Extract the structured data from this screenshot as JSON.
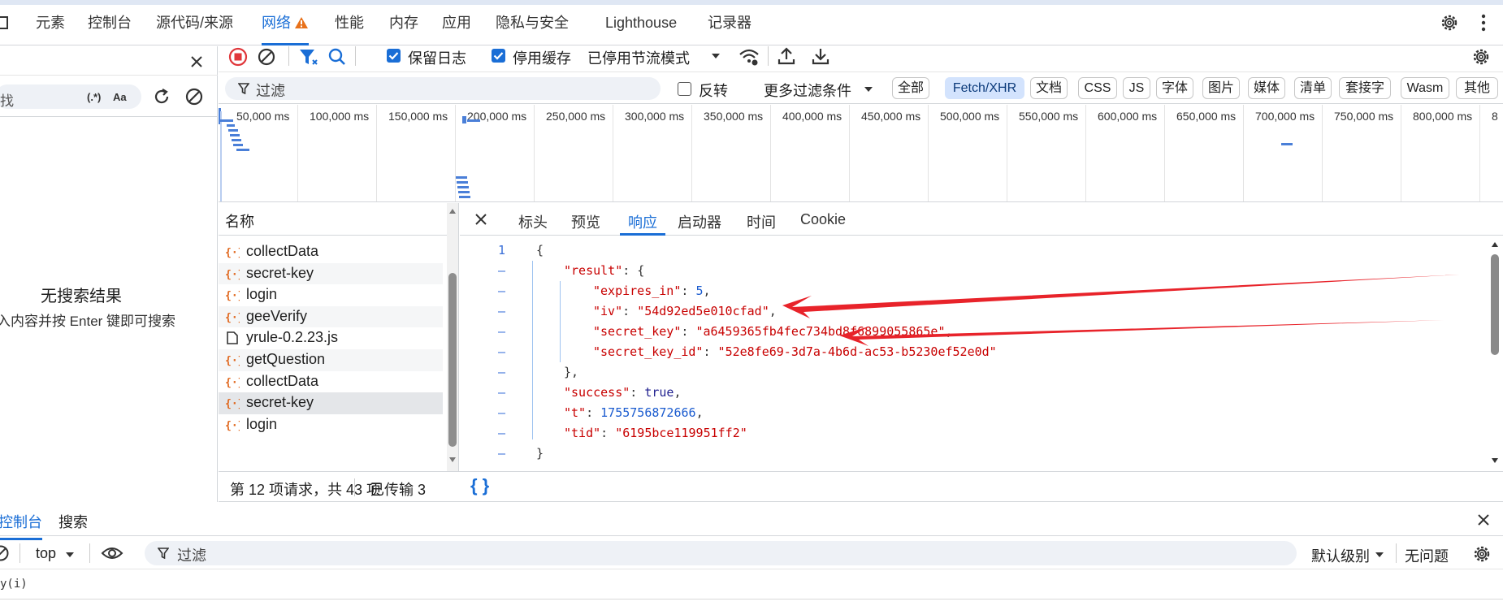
{
  "top_tabs": [
    "元素",
    "控制台",
    "源代码/来源",
    "网络",
    "性能",
    "内存",
    "应用",
    "隐私与安全",
    "Lighthouse",
    "记录器"
  ],
  "active_top_tab": "网络",
  "search_pane": {
    "placeholder": "找",
    "regex_toggle": "(.*)",
    "case_toggle": "Aa",
    "no_results_title": "无搜索结果",
    "no_results_hint": "入内容并按 Enter 键即可搜索"
  },
  "toolbar": {
    "preserve_log_label": "保留日志",
    "preserve_log_checked": true,
    "disable_cache_label": "停用缓存",
    "disable_cache_checked": true,
    "throttling_value": "已停用节流模式"
  },
  "filter": {
    "placeholder": "过滤",
    "invert_label": "反转",
    "invert_checked": false,
    "more_filters_label": "更多过滤条件",
    "types": [
      "全部",
      "Fetch/XHR",
      "文档",
      "CSS",
      "JS",
      "字体",
      "图片",
      "媒体",
      "清单",
      "套接字",
      "Wasm",
      "其他"
    ],
    "active_type": "Fetch/XHR"
  },
  "overview": {
    "tick_labels": [
      "50,000 ms",
      "100,000 ms",
      "150,000 ms",
      "200,000 ms",
      "250,000 ms",
      "300,000 ms",
      "350,000 ms",
      "400,000 ms",
      "450,000 ms",
      "500,000 ms",
      "550,000 ms",
      "600,000 ms",
      "650,000 ms",
      "700,000 ms",
      "750,000 ms",
      "800,000 ms",
      "8"
    ]
  },
  "requests": {
    "column_header": "名称",
    "rows": [
      {
        "name": "collectData",
        "kind": "xhr"
      },
      {
        "name": "secret-key",
        "kind": "xhr"
      },
      {
        "name": "login",
        "kind": "xhr"
      },
      {
        "name": "geeVerify",
        "kind": "xhr"
      },
      {
        "name": "yrule-0.2.23.js",
        "kind": "doc"
      },
      {
        "name": "getQuestion",
        "kind": "xhr"
      },
      {
        "name": "collectData",
        "kind": "xhr"
      },
      {
        "name": "secret-key",
        "kind": "xhr",
        "selected": true
      },
      {
        "name": "login",
        "kind": "xhr"
      }
    ]
  },
  "detail": {
    "tabs": [
      "标头",
      "预览",
      "响应",
      "启动器",
      "时间",
      "Cookie"
    ],
    "active_tab": "响应",
    "line_numbers": [
      "1",
      "–",
      "–",
      "–",
      "–",
      "–",
      "–",
      "–",
      "–",
      "–",
      "–"
    ],
    "response": {
      "result": {
        "expires_in": "5",
        "iv": "54d92ed5e010cfad",
        "secret_key": "a6459365fb4fec734bd8f6899055865e",
        "secret_key_id": "52e8fe69-3d7a-4b6d-ac53-b5230ef52e0d"
      },
      "success": "true",
      "t": "1755756872666",
      "tid": "6195bce119951ff2"
    }
  },
  "status": {
    "count_text": "第 12 项请求，共 43 项",
    "transferred_text": "已传输 3"
  },
  "drawer": {
    "tabs": [
      "控制台",
      "搜索"
    ],
    "active_tab": "控制台",
    "context": "top",
    "filter_placeholder": "过滤",
    "level": "默认级别",
    "issues": "无问题",
    "console_text": "y(i)"
  },
  "colors": {
    "accent": "#1a6ed6",
    "arrow": "#e8232a",
    "record": "#e0363a",
    "json_string": "#c80000",
    "json_number": "#1a5bcf"
  }
}
